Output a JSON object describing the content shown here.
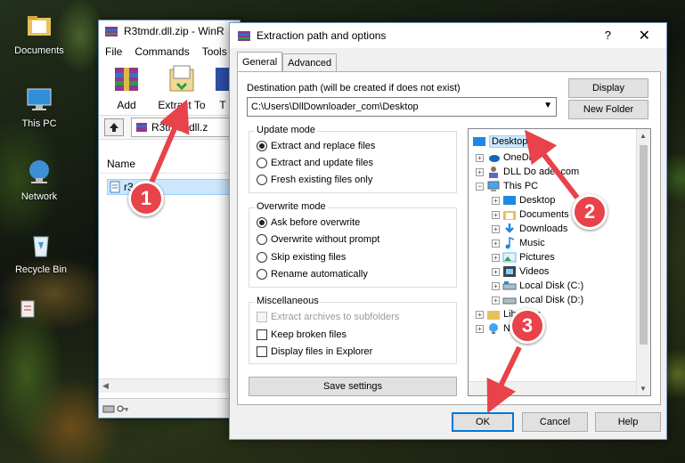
{
  "desktop": {
    "icons": [
      {
        "label": "Documents",
        "icon": "folder-documents-icon"
      },
      {
        "label": "This PC",
        "icon": "computer-icon"
      },
      {
        "label": "Network",
        "icon": "network-icon"
      },
      {
        "label": "Recycle Bin",
        "icon": "recycle-bin-icon"
      }
    ]
  },
  "winrar": {
    "title": "R3tmdr.dll.zip - WinR",
    "menu": [
      "File",
      "Commands",
      "Tools"
    ],
    "tools": [
      {
        "label": "Add",
        "icon": "add-archive-icon"
      },
      {
        "label": "Extract To",
        "icon": "extract-to-icon"
      },
      {
        "label": "T",
        "icon": "test-icon"
      }
    ],
    "address": "R3tmdr.dll.z",
    "column_name": "Name",
    "file_name": "r3 dll"
  },
  "dialog": {
    "title": "Extraction path and options",
    "help_symbol": "?",
    "close_symbol": "✕",
    "tabs": [
      "General",
      "Advanced"
    ],
    "destination_label": "Destination path (will be created if does not exist)",
    "destination_value": "C:\\Users\\DllDownloader_com\\Desktop",
    "display_button": "Display",
    "new_folder_button": "New Folder",
    "update_mode": {
      "title": "Update mode",
      "options": [
        "Extract and replace files",
        "Extract and update files",
        "Fresh existing files only"
      ],
      "selected": 0
    },
    "overwrite_mode": {
      "title": "Overwrite mode",
      "options": [
        "Ask before overwrite",
        "Overwrite without prompt",
        "Skip existing files",
        "Rename automatically"
      ],
      "selected": 0
    },
    "misc": {
      "title": "Miscellaneous",
      "options": [
        "Extract archives to subfolders",
        "Keep broken files",
        "Display files in Explorer"
      ]
    },
    "save_settings": "Save settings",
    "tree": [
      {
        "label": "Desktop",
        "level": 0,
        "icon": "desktop-folder-icon",
        "selected": true
      },
      {
        "label": "OneDr",
        "level": 1,
        "icon": "onedrive-icon"
      },
      {
        "label": "DLL Do      ader.com",
        "level": 1,
        "icon": "user-folder-icon"
      },
      {
        "label": "This PC",
        "level": 1,
        "icon": "computer-icon"
      },
      {
        "label": "Desktop",
        "level": 2,
        "icon": "desktop-folder-icon"
      },
      {
        "label": "Documents",
        "level": 2,
        "icon": "documents-folder-icon"
      },
      {
        "label": "Downloads",
        "level": 2,
        "icon": "downloads-folder-icon"
      },
      {
        "label": "Music",
        "level": 2,
        "icon": "music-folder-icon"
      },
      {
        "label": "Pictures",
        "level": 2,
        "icon": "pictures-folder-icon"
      },
      {
        "label": "Videos",
        "level": 2,
        "icon": "videos-folder-icon"
      },
      {
        "label": "Local Disk (C:)",
        "level": 2,
        "icon": "disk-icon"
      },
      {
        "label": "Local Disk (D:)",
        "level": 2,
        "icon": "disk-icon"
      },
      {
        "label": "Libraries",
        "level": 1,
        "icon": "libraries-icon"
      },
      {
        "label": "Ne",
        "level": 1,
        "icon": "network-icon"
      }
    ],
    "ok_button": "OK",
    "cancel_button": "Cancel",
    "help_button": "Help"
  },
  "steps": [
    "1",
    "2",
    "3"
  ],
  "colors": {
    "step_marker": "#e8424a",
    "selection": "#cce8ff",
    "ok_border": "#0078d7"
  }
}
